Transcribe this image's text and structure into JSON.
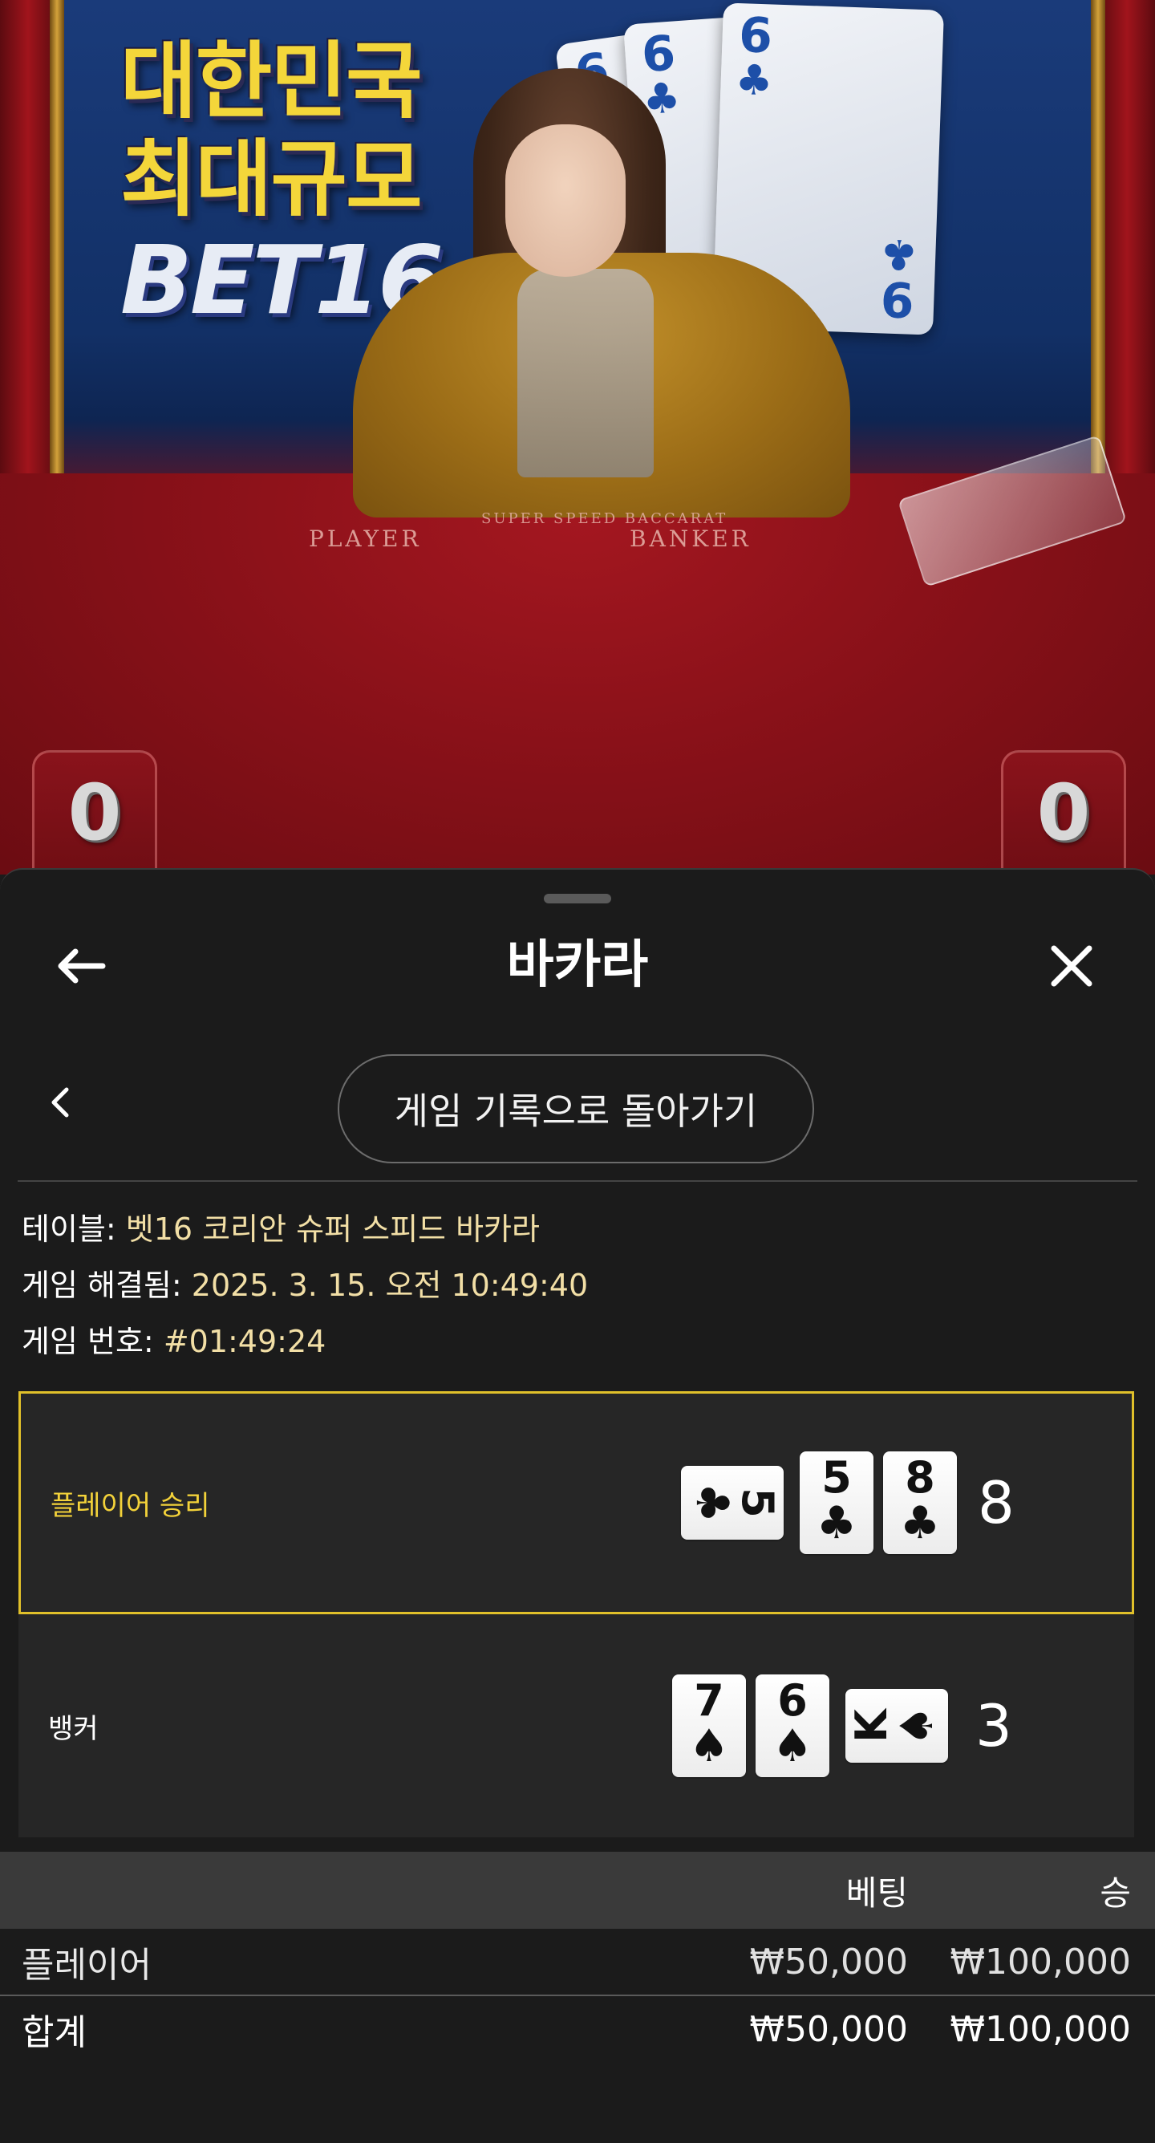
{
  "video": {
    "promo_lines": [
      "대한민국",
      "최대규모"
    ],
    "promo_brand": "BET16",
    "table_labels": {
      "player": "PLAYER",
      "banker": "BANKER",
      "brand": "SUPER SPEED BACCARAT"
    },
    "big_cards": [
      {
        "rank": "6",
        "suit": "♣"
      },
      {
        "rank": "6",
        "suit": "♣"
      },
      {
        "rank": "6",
        "suit": "♣",
        "bottom_rank": "9"
      }
    ],
    "scores": {
      "player": "0",
      "banker": "0"
    }
  },
  "sheet": {
    "title": "바카라",
    "back_icon": "arrow-left-icon",
    "close_icon": "close-icon",
    "prev_icon": "chevron-left-icon",
    "history_button": "게임 기록으로 돌아가기"
  },
  "info": {
    "table_label": "테이블: ",
    "table_value": "벳16 코리안 슈퍼 스피드 바카라",
    "resolved_label": "게임 해결됨: ",
    "resolved_value": "2025. 3. 15. 오전 10:49:40",
    "number_label": "게임 번호: ",
    "number_value": "#01:49:24"
  },
  "hands": {
    "player": {
      "label": "플레이어 승리",
      "total": "8",
      "cards": [
        {
          "rank": "5",
          "suit": "♣",
          "orientation": "sideways"
        },
        {
          "rank": "5",
          "suit": "♣",
          "orientation": "upright"
        },
        {
          "rank": "8",
          "suit": "♣",
          "orientation": "upright"
        }
      ]
    },
    "banker": {
      "label": "뱅커",
      "total": "3",
      "cards": [
        {
          "rank": "7",
          "suit": "♠",
          "orientation": "upright"
        },
        {
          "rank": "6",
          "suit": "♠",
          "orientation": "upright"
        },
        {
          "rank": "K",
          "suit": "♠",
          "orientation": "sideways"
        }
      ]
    }
  },
  "bets": {
    "headers": {
      "name": "",
      "bet": "베팅",
      "win": "승"
    },
    "rows": [
      {
        "name": "플레이어",
        "bet": "₩50,000",
        "win": "₩100,000"
      }
    ],
    "total": {
      "name": "합계",
      "bet": "₩50,000",
      "win": "₩100,000"
    }
  },
  "colors": {
    "accent_gold": "#e0c02a",
    "winner_text": "#f3d23a",
    "info_value": "#f2dfa6",
    "sheet_bg": "#1b1b1b",
    "card_panel": "#262626",
    "header_bg": "#3a3a3a"
  }
}
